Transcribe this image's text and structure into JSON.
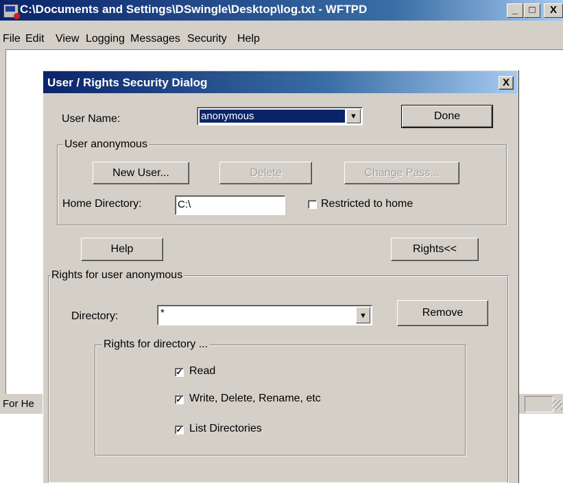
{
  "window": {
    "title": "C:\\Documents and Settings\\DSwingle\\Desktop\\log.txt - WFTPD",
    "minimize": "_",
    "maximize": "□",
    "close": "X",
    "status_text": "For He"
  },
  "menu": [
    "File",
    "Edit",
    "View",
    "Logging",
    "Messages",
    "Security",
    "Help"
  ],
  "dialog": {
    "title": "User / Rights Security Dialog",
    "close": "X",
    "user_name_label": "User Name:",
    "user_name_value": "anonymous",
    "done_button": "Done",
    "user_group_title": "User anonymous",
    "new_user_button": "New User...",
    "delete_button": "Delete",
    "change_pass_button": "Change Pass...",
    "home_dir_label": "Home Directory:",
    "home_dir_value": "C:\\",
    "restricted_label": "Restricted to home",
    "restricted_checked": false,
    "help_button": "Help",
    "rights_button": "Rights<<",
    "rights_group_title": "Rights for user anonymous",
    "directory_label": "Directory:",
    "directory_value": "*",
    "remove_button": "Remove",
    "dir_rights_group_title": "Rights for directory ...",
    "rights": [
      {
        "label": "Read",
        "checked": true
      },
      {
        "label": "Write, Delete, Rename, etc",
        "checked": true
      },
      {
        "label": "List Directories",
        "checked": true
      }
    ]
  }
}
